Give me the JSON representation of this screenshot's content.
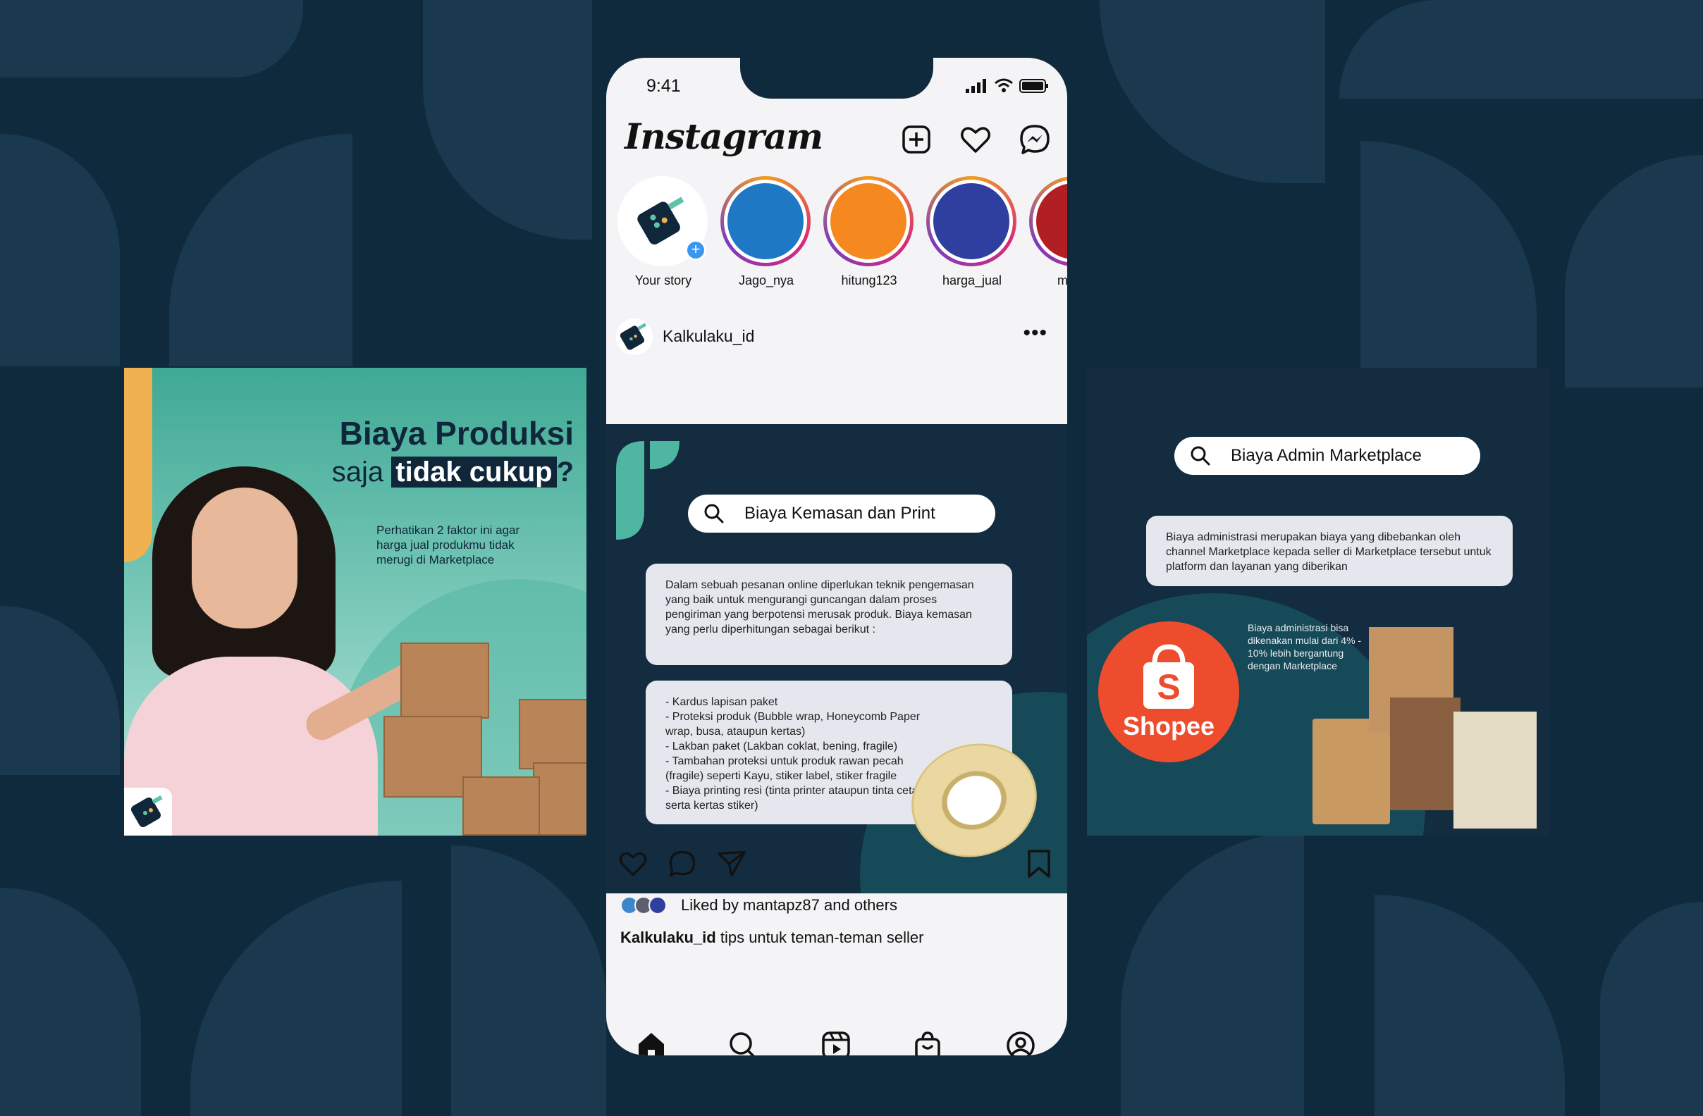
{
  "status_bar": {
    "time": "9:41"
  },
  "app": {
    "name": "Instagram"
  },
  "stories": [
    {
      "label": "Your story",
      "color": "#ffffff"
    },
    {
      "label": "Jago_nya",
      "color": "#1f78c4"
    },
    {
      "label": "hitung123",
      "color": "#f5891f"
    },
    {
      "label": "harga_jual",
      "color": "#2f3fa0"
    },
    {
      "label": "mateo",
      "color": "#b11e24"
    }
  ],
  "post": {
    "username": "Kalkulaku_id",
    "likes_text": "Liked by mantapz87 and others",
    "caption_user": "Kalkulaku_id",
    "caption_text": "tips untuk teman-teman seller"
  },
  "slide_left": {
    "title_line1": "Biaya Produksi",
    "title_saja": "saja",
    "title_highlight": "tidak cukup",
    "title_q": "?",
    "subtitle": "Perhatikan 2 faktor ini agar harga jual produkmu tidak merugi di Marketplace"
  },
  "slide_middle": {
    "search": "Biaya Kemasan dan Print",
    "card1": "Dalam sebuah pesanan online diperlukan teknik pengemasan yang baik untuk mengurangi guncangan dalam proses pengiriman yang berpotensi merusak produk. Biaya kemasan yang perlu diperhitungan sebagai berikut :",
    "list": [
      "- Kardus lapisan paket",
      "- Proteksi produk (Bubble wrap, Honeycomb Paper wrap, busa, ataupun kertas)",
      "- Lakban paket (Lakban coklat, bening, fragile)",
      "- Tambahan proteksi untuk produk rawan pecah (fragile) seperti Kayu, stiker label, stiker fragile",
      "- Biaya printing resi (tinta printer ataupun tinta cetak serta kertas stiker)"
    ]
  },
  "slide_right": {
    "search": "Biaya Admin Marketplace",
    "card": "Biaya administrasi merupakan biaya yang dibebankan oleh channel Marketplace kepada seller di Marketplace tersebut untuk platform dan layanan yang diberikan",
    "note": "Biaya administrasi bisa dikenakan mulai dari 4% - 10% lebih bergantung dengan Marketplace",
    "brand": "Shopee"
  }
}
